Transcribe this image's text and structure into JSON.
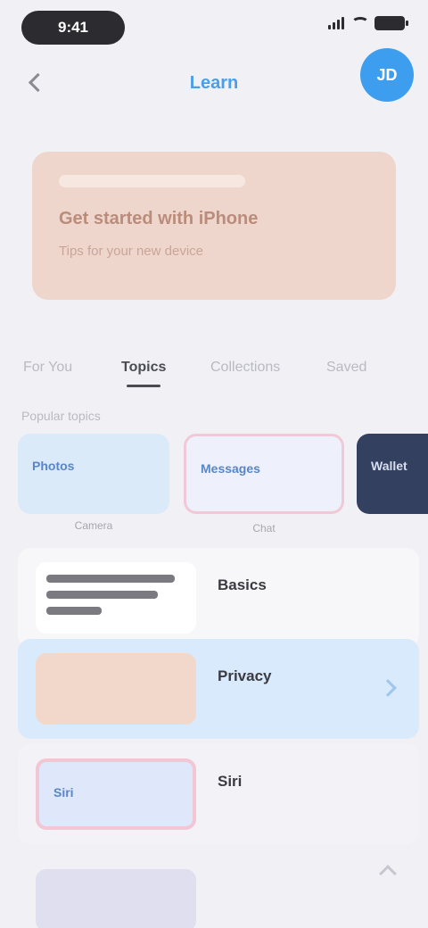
{
  "status_bar": {
    "time": "9:41"
  },
  "header": {
    "title": "Learn",
    "avatar_initials": "JD"
  },
  "banner": {
    "headline": "Get started with iPhone",
    "subtitle": "Tips for your new device"
  },
  "tabs": [
    {
      "label": "For You",
      "active": false
    },
    {
      "label": "Topics",
      "active": true
    },
    {
      "label": "Collections",
      "active": false
    },
    {
      "label": "Saved",
      "active": false
    }
  ],
  "section": {
    "label": "Popular topics"
  },
  "cards": [
    {
      "label": "Photos",
      "caption": "Camera"
    },
    {
      "label": "Messages",
      "caption": "Chat"
    },
    {
      "label": "Wallet",
      "caption": ""
    }
  ],
  "list": [
    {
      "title": "Basics",
      "subtitle": ""
    },
    {
      "title": "Privacy",
      "subtitle": ""
    },
    {
      "title": "Siri",
      "subtitle": "",
      "thumb_text": "Siri"
    },
    {
      "title": "",
      "subtitle": ""
    }
  ],
  "colors": {
    "accent": "#3d9ef0",
    "banner": "#efd6cc",
    "highlight_row": "#d8eafb"
  }
}
